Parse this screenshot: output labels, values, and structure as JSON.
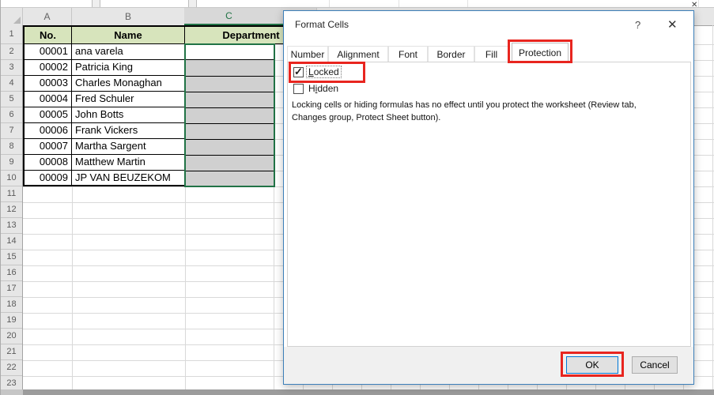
{
  "spreadsheet": {
    "column_headers": [
      "A",
      "B",
      "C"
    ],
    "row_numbers": [
      1,
      2,
      3,
      4,
      5,
      6,
      7,
      8,
      9,
      10,
      11,
      12,
      13,
      14,
      15,
      16,
      17,
      18,
      19,
      20,
      21,
      22,
      23
    ],
    "partial_glyph": "✕",
    "table": {
      "headers": [
        "No.",
        "Name",
        "Department"
      ],
      "rows": [
        [
          "00001",
          "ana varela"
        ],
        [
          "00002",
          "Patricia King"
        ],
        [
          "00003",
          "Charles Monaghan"
        ],
        [
          "00004",
          "Fred Schuler"
        ],
        [
          "00005",
          "John Botts"
        ],
        [
          "00006",
          "Frank Vickers"
        ],
        [
          "00007",
          "Martha Sargent"
        ],
        [
          "00008",
          "Matthew Martin"
        ],
        [
          "00009",
          "JP VAN BEUZEKOM"
        ]
      ]
    },
    "selection": {
      "range": "C2:C10",
      "active_cell": "C2",
      "selected_column": "C"
    }
  },
  "dialog": {
    "title": "Format Cells",
    "help_glyph": "?",
    "close_glyph": "✕",
    "tabs": [
      "Number",
      "Alignment",
      "Font",
      "Border",
      "Fill",
      "Protection"
    ],
    "active_tab": "Protection",
    "protection_tab": {
      "locked_checkbox": {
        "checked": true,
        "checkmark": "✓",
        "label_key": "L",
        "label_rest": "ocked"
      },
      "hidden_checkbox": {
        "checked": false,
        "label_pre": "H",
        "label_key": "i",
        "label_rest": "dden"
      },
      "note": "Locking cells or hiding formulas has no effect until you protect the worksheet (Review tab,\nChanges group, Protect Sheet button)."
    },
    "ok_label": "OK",
    "cancel_label": "Cancel"
  },
  "annotations": {
    "highlight_color": "#E8251F",
    "highlighted": [
      "Protection tab",
      "Locked checkbox",
      "OK button"
    ]
  },
  "colors": {
    "selection_green": "#217346",
    "header_fill_green": "#D7E4BC",
    "selected_cell_gray": "#D0D0D0",
    "dialog_border_blue": "#3C7FB9",
    "ok_border_blue": "#0078D7"
  }
}
